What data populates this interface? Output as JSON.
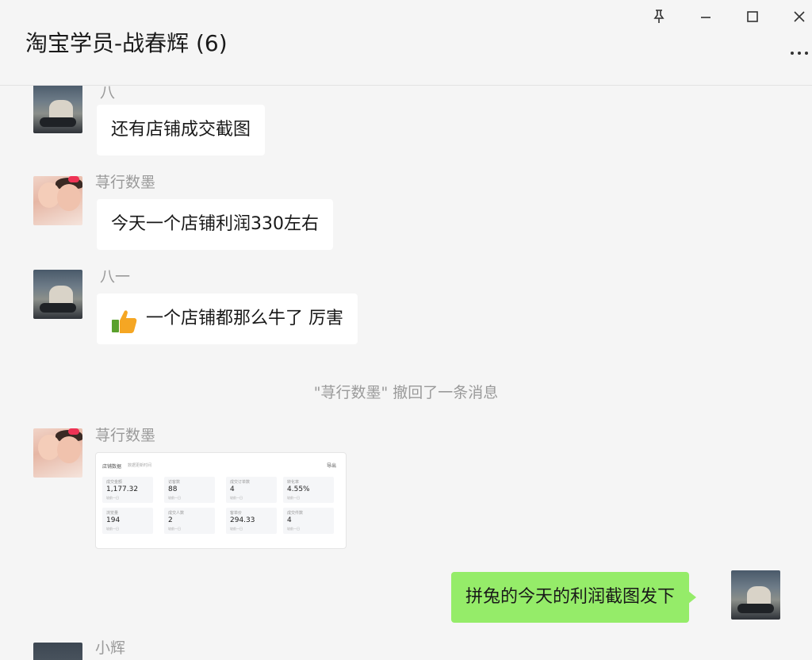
{
  "window": {
    "title": "淘宝学员-战春辉 (6)",
    "pin_icon": "pin-icon",
    "minimize_icon": "minimize-icon",
    "maximize_icon": "maximize-icon",
    "close_icon": "close-icon",
    "more_icon": "more-icon"
  },
  "messages": [
    {
      "sender": "八",
      "text": "还有店铺成交截图"
    },
    {
      "sender": "荨行数墨",
      "text": "今天一个店铺利润330左右"
    },
    {
      "sender": "八一",
      "text": "一个店铺都那么牛了 厉害",
      "emoji": "thumbs-up-icon"
    },
    {
      "sender": "荨行数墨",
      "image": "shop-data-screenshot"
    },
    {
      "sender": "me",
      "text": "拼兔的今天的利润截图发下"
    },
    {
      "sender": "小辉"
    }
  ],
  "system_notice": "\"荨行数墨\" 撤回了一条消息",
  "card": {
    "title": "店铺数据",
    "subtitle": "数据更新时间",
    "button": "导出",
    "tiles": [
      {
        "label": "成交金额",
        "value": "1,177.32",
        "sub": "较前一日"
      },
      {
        "label": "访客数",
        "value": "88",
        "sub": "较前一日"
      },
      {
        "label": "成交订单数",
        "value": "4",
        "sub": "较前一日"
      },
      {
        "label": "转化率",
        "value": "4.55%",
        "sub": "较前一日"
      },
      {
        "label": "浏览量",
        "value": "194",
        "sub": "较前一日"
      },
      {
        "label": "成交人数",
        "value": "2",
        "sub": "较前一日"
      },
      {
        "label": "客单价",
        "value": "294.33",
        "sub": "较前一日"
      },
      {
        "label": "成交件数",
        "value": "4",
        "sub": "较前一日"
      }
    ]
  },
  "colors": {
    "background": "#f5f5f5",
    "bubble_other": "#ffffff",
    "bubble_me": "#95ec69",
    "name_text": "#9a9a9a"
  }
}
